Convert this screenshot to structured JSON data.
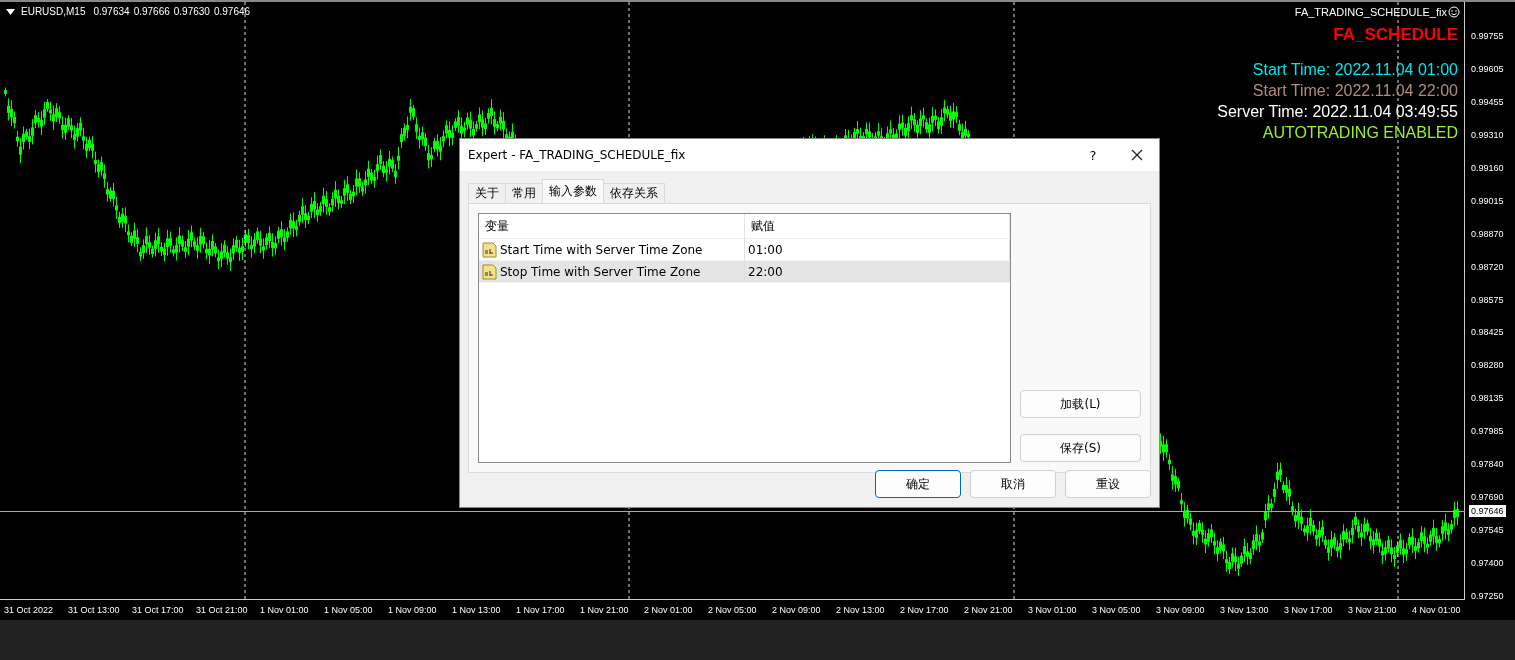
{
  "chart": {
    "symbol": "EURUSD,M15",
    "quotes": [
      "0.97634",
      "0.97666",
      "0.97630",
      "0.97646"
    ],
    "expert_name": "FA_TRADING_SCHEDULE_fix",
    "overlay_title": {
      "text": "FA_SCHEDULE",
      "color": "#ff0000"
    },
    "overlay_lines": [
      {
        "text": "Start Time: 2022.11.04 01:00",
        "color": "#00e5ee"
      },
      {
        "text": "Start Time: 2022.11.04 22:00",
        "color": "#b08a80"
      },
      {
        "text": "Server Time: 2022.11.04 03:49:55",
        "color": "#ffffff"
      },
      {
        "text": "AUTOTRADING ENABLED",
        "color": "#9aef2a"
      }
    ],
    "price_labels": [
      "0.99755",
      "0.99605",
      "0.99455",
      "0.99310",
      "0.99160",
      "0.99015",
      "0.98870",
      "0.98720",
      "0.98575",
      "0.98425",
      "0.98280",
      "0.98135",
      "0.97985",
      "0.97840",
      "0.97690",
      "0.97545",
      "0.97400",
      "0.97250"
    ],
    "current_price": "0.97646",
    "time_labels": [
      "31 Oct 2022",
      "31 Oct 13:00",
      "31 Oct 17:00",
      "31 Oct 21:00",
      "1 Nov 01:00",
      "1 Nov 05:00",
      "1 Nov 09:00",
      "1 Nov 13:00",
      "1 Nov 17:00",
      "1 Nov 21:00",
      "2 Nov 01:00",
      "2 Nov 05:00",
      "2 Nov 09:00",
      "2 Nov 13:00",
      "2 Nov 17:00",
      "2 Nov 21:00",
      "3 Nov 01:00",
      "3 Nov 05:00",
      "3 Nov 09:00",
      "3 Nov 13:00",
      "3 Nov 17:00",
      "3 Nov 21:00",
      "4 Nov 01:00"
    ]
  },
  "dialog": {
    "title": "Expert - FA_TRADING_SCHEDULE_fix",
    "help": "?",
    "tabs": [
      {
        "label": "关于",
        "selected": false
      },
      {
        "label": "常用",
        "selected": false
      },
      {
        "label": "输入参数",
        "selected": true
      },
      {
        "label": "依存关系",
        "selected": false
      }
    ],
    "table": {
      "columns": [
        "变量",
        "赋值"
      ],
      "rows": [
        {
          "name": "Start Time with Server Time Zone",
          "value": "01:00",
          "selected": false
        },
        {
          "name": "Stop Time with Server Time Zone",
          "value": "22:00",
          "selected": true
        }
      ]
    },
    "side_buttons": [
      "加载(L)",
      "保存(S)"
    ],
    "buttons": [
      {
        "label": "确定",
        "default": true
      },
      {
        "label": "取消",
        "default": false
      },
      {
        "label": "重设",
        "default": false
      }
    ]
  }
}
